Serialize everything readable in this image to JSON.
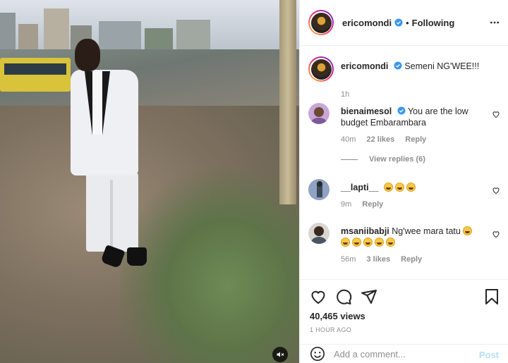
{
  "post": {
    "author": "ericomondi",
    "follow_status": "Following",
    "caption": "Semeni NG'WEE!!!",
    "caption_time": "1h",
    "views": "40,465 views",
    "posted_ago": "1 HOUR AGO"
  },
  "comments": [
    {
      "username": "bienaimesol",
      "verified": true,
      "text": "You are the low budget Embarambara",
      "time": "40m",
      "likes": "22 likes",
      "reply": "Reply",
      "view_replies": "View replies (6)"
    },
    {
      "username": "__lapti__",
      "verified": false,
      "text": "",
      "emoji_count": 3,
      "time": "9m",
      "likes": "",
      "reply": "Reply"
    },
    {
      "username": "msaniibabji",
      "verified": false,
      "text": "Ng'wee mara tatu",
      "emoji_count": 6,
      "time": "56m",
      "likes": "3 likes",
      "reply": "Reply"
    }
  ],
  "comment_box": {
    "placeholder": "Add a comment...",
    "post_label": "Post"
  },
  "colors": {
    "accent": "#0095f6",
    "verified": "#3897f0",
    "post_disabled": "#b2dffc"
  },
  "icons": [
    "mute-icon",
    "more-icon",
    "verified-icon",
    "heart-icon",
    "comment-icon",
    "share-icon",
    "bookmark-icon",
    "emoji-icon"
  ]
}
